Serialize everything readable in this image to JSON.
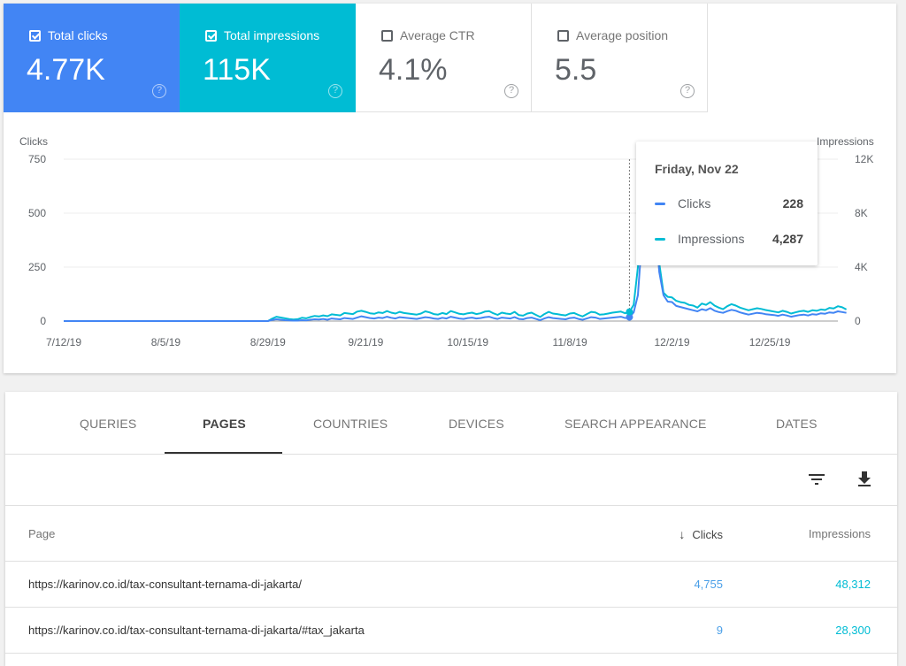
{
  "metrics": [
    {
      "label": "Total clicks",
      "value": "4.77K",
      "checked": true,
      "color": "#4285f4"
    },
    {
      "label": "Total impressions",
      "value": "115K",
      "checked": true,
      "color": "#00bcd4"
    },
    {
      "label": "Average CTR",
      "value": "4.1%",
      "checked": false
    },
    {
      "label": "Average position",
      "value": "5.5",
      "checked": false
    }
  ],
  "help_glyph": "?",
  "chart_data": {
    "type": "line",
    "left_axis_title": "Clicks",
    "right_axis_title": "Impressions",
    "left_ticks": [
      "750",
      "500",
      "250",
      "0"
    ],
    "right_ticks": [
      "12K",
      "8K",
      "4K",
      "0"
    ],
    "left_ylim": [
      0,
      750
    ],
    "right_ylim": [
      0,
      12000
    ],
    "x_ticks": [
      "7/12/19",
      "8/5/19",
      "8/29/19",
      "9/21/19",
      "10/15/19",
      "11/8/19",
      "12/2/19",
      "12/25/19"
    ],
    "x_start": "2019-07-12",
    "x_days": 183,
    "grid": true,
    "series": [
      {
        "name": "Clicks",
        "axis": "left",
        "color": "#4285f4",
        "values": [
          0,
          0,
          0,
          0,
          0,
          0,
          0,
          0,
          0,
          0,
          0,
          0,
          0,
          0,
          0,
          0,
          0,
          0,
          0,
          0,
          0,
          0,
          0,
          0,
          0,
          0,
          0,
          0,
          0,
          0,
          0,
          0,
          0,
          0,
          0,
          0,
          0,
          0,
          0,
          0,
          0,
          0,
          0,
          0,
          0,
          0,
          0,
          0,
          0,
          5,
          8,
          6,
          4,
          3,
          2,
          2,
          4,
          3,
          6,
          8,
          7,
          10,
          6,
          12,
          10,
          8,
          14,
          12,
          10,
          16,
          22,
          18,
          14,
          12,
          16,
          14,
          20,
          15,
          12,
          18,
          16,
          14,
          12,
          10,
          14,
          18,
          16,
          12,
          10,
          15,
          12,
          20,
          16,
          12,
          10,
          14,
          16,
          12,
          14,
          18,
          20,
          14,
          10,
          16,
          14,
          12,
          18,
          10,
          8,
          14,
          16,
          10,
          4,
          12,
          18,
          14,
          12,
          10,
          8,
          14,
          16,
          10,
          6,
          12,
          18,
          16,
          10,
          12,
          14,
          16,
          18,
          20,
          14,
          18,
          40,
          120,
          400,
          745,
          620,
          500,
          228,
          120,
          90,
          88,
          70,
          65,
          60,
          55,
          50,
          45,
          55,
          50,
          60,
          48,
          42,
          38,
          46,
          52,
          48,
          40,
          35,
          30,
          34,
          38,
          36,
          32,
          30,
          28,
          24,
          30,
          26,
          20,
          24,
          28,
          30,
          26,
          32,
          30,
          36,
          34,
          40,
          38,
          45,
          42,
          38
        ]
      },
      {
        "name": "Impressions",
        "axis": "right",
        "color": "#00bcd4",
        "values": [
          0,
          0,
          0,
          0,
          0,
          0,
          0,
          0,
          0,
          0,
          0,
          0,
          0,
          0,
          0,
          0,
          0,
          0,
          0,
          0,
          0,
          0,
          0,
          0,
          0,
          0,
          0,
          0,
          0,
          0,
          0,
          0,
          0,
          0,
          0,
          0,
          0,
          0,
          0,
          0,
          0,
          0,
          0,
          0,
          0,
          0,
          0,
          0,
          0,
          180,
          320,
          260,
          200,
          150,
          120,
          140,
          240,
          200,
          300,
          380,
          340,
          420,
          360,
          500,
          460,
          420,
          600,
          560,
          520,
          700,
          760,
          680,
          580,
          540,
          640,
          600,
          740,
          620,
          560,
          680,
          600,
          560,
          520,
          480,
          560,
          720,
          640,
          520,
          480,
          600,
          520,
          740,
          640,
          540,
          500,
          580,
          620,
          520,
          580,
          700,
          740,
          580,
          460,
          620,
          560,
          520,
          680,
          440,
          400,
          560,
          620,
          460,
          300,
          520,
          680,
          560,
          520,
          460,
          420,
          560,
          600,
          460,
          340,
          520,
          680,
          640,
          480,
          500,
          560,
          620,
          660,
          700,
          580,
          680,
          1200,
          4000,
          9000,
          11800,
          10000,
          7000,
          4287,
          2100,
          1800,
          1750,
          1500,
          1400,
          1350,
          1200,
          1150,
          1000,
          1300,
          1200,
          1400,
          1150,
          1000,
          880,
          1100,
          1250,
          1150,
          1000,
          900,
          800,
          880,
          950,
          900,
          820,
          760,
          700,
          640,
          760,
          680,
          560,
          640,
          720,
          760,
          680,
          800,
          760,
          860,
          820,
          980,
          940,
          1100,
          1020,
          860
        ]
      }
    ],
    "tooltip": {
      "date": "Friday, Nov 22",
      "rows": [
        {
          "label": "Clicks",
          "value": "228",
          "color": "#4285f4"
        },
        {
          "label": "Impressions",
          "value": "4,287",
          "color": "#00bcd4"
        }
      ]
    },
    "hover_index": 133
  },
  "tabs": [
    {
      "label": "QUERIES",
      "active": false
    },
    {
      "label": "PAGES",
      "active": true
    },
    {
      "label": "COUNTRIES",
      "active": false
    },
    {
      "label": "DEVICES",
      "active": false
    },
    {
      "label": "SEARCH APPEARANCE",
      "active": false
    },
    {
      "label": "DATES",
      "active": false
    }
  ],
  "toolbar": {
    "filter_icon": "filter-icon",
    "download_icon": "download-icon"
  },
  "table": {
    "headers": {
      "page": "Page",
      "clicks": "Clicks",
      "impressions": "Impressions",
      "sort_arrow": "↓"
    },
    "rows": [
      {
        "page": "https://karinov.co.id/tax-consultant-ternama-di-jakarta/",
        "clicks": "4,755",
        "impressions": "48,312"
      },
      {
        "page": "https://karinov.co.id/tax-consultant-ternama-di-jakarta/#tax_jakarta",
        "clicks": "9",
        "impressions": "28,300"
      }
    ]
  }
}
